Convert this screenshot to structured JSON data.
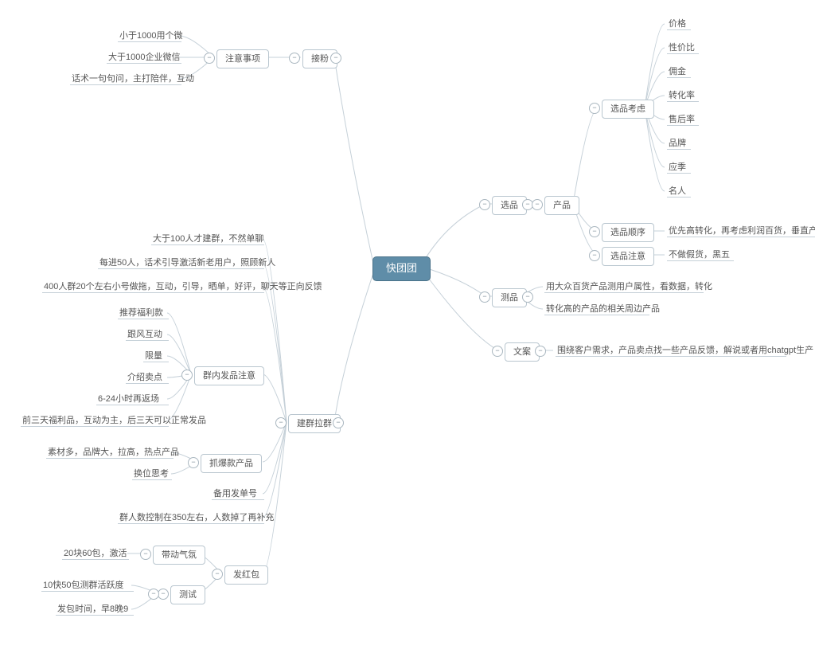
{
  "root": "快团团",
  "left": {
    "jiefen": {
      "label": "接粉",
      "sub": {
        "label": "注意事项",
        "items": [
          "小于1000用个微",
          "大于1000企业微信",
          "话术一句句问，主打陪伴，互动"
        ]
      }
    },
    "jianqun": {
      "label": "建群拉群",
      "top3": [
        "大于100人才建群，不然单聊",
        "每进50人，话术引导激活新老用户，照顾新人",
        "400人群20个左右小号做拖，互动，引导，晒单，好评，聊天等正向反馈"
      ],
      "qunnei": {
        "label": "群内发品注意",
        "items": [
          "推荐福利款",
          "跟风互动",
          "限量",
          "介绍卖点",
          "6-24小时再返场",
          "前三天福利品，互动为主，后三天可以正常发品"
        ]
      },
      "zhuabao": {
        "label": "抓爆款产品",
        "items": [
          "素材多，品牌大，拉高，热点产品",
          "换位思考"
        ]
      },
      "bei": "备用发单号",
      "renkong": "群人数控制在350左右，人数掉了再补充",
      "hongbao": {
        "label": "发红包",
        "qifen": {
          "label": "带动气氛",
          "item": "20块60包，激活"
        },
        "ceshi": {
          "label": "测试",
          "items": [
            "10快50包测群活跃度",
            "发包时间，早8晚9"
          ]
        }
      }
    }
  },
  "right": {
    "xuanpin": {
      "label": "选品",
      "chanpin": "产品",
      "kaoliang": {
        "label": "选品考虑",
        "items": [
          "价格",
          "性价比",
          "佣金",
          "转化率",
          "售后率",
          "品牌",
          "应季",
          "名人"
        ]
      },
      "shunxu": {
        "label": "选品顺序",
        "text": "优先高转化，再考虑利润百货，垂直产品，品牌产品"
      },
      "zhuyi": {
        "label": "选品注意",
        "text": "不做假货，黑五"
      }
    },
    "cepin": {
      "label": "测品",
      "items": [
        "用大众百货产品测用户属性，看数据，转化",
        "转化高的产品的相关周边产品"
      ]
    },
    "wenan": {
      "label": "文案",
      "text": "围绕客户需求，产品卖点找一些产品反馈，解说或者用chatgpt生产"
    }
  },
  "toggle": "−"
}
